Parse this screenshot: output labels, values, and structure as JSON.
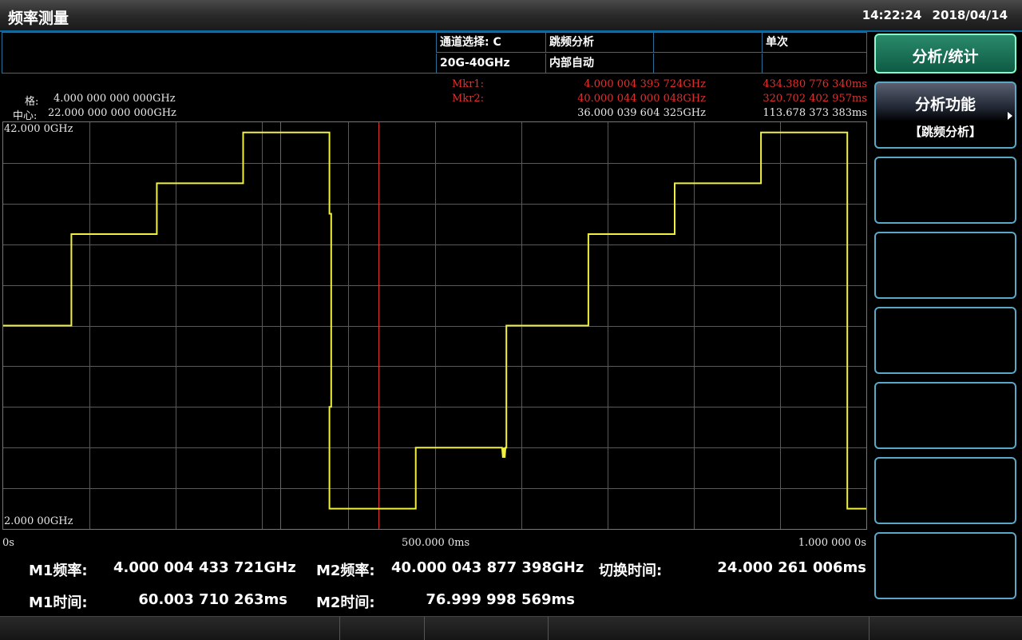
{
  "window": {
    "title": "频率测量",
    "time": "14:22:24",
    "date": "2018/04/14"
  },
  "info": {
    "channel_label": "通道选择: C",
    "band": "20G-40GHz",
    "mode": "跳频分析",
    "trigger": "内部自动",
    "sweep": "单次"
  },
  "scale": {
    "per_div_label": "格:",
    "per_div_value": "4.000 000 000 000GHz",
    "center_label": "中心:",
    "center_value": "22.000 000 000 000GHz"
  },
  "markers": {
    "mkr1_label": "Mkr1:",
    "mkr1_freq": "4.000 004 395 724GHz",
    "mkr1_time": "434.380 776 340ms",
    "mkr2_label": "Mkr2:",
    "mkr2_freq": "40.000 044 000 048GHz",
    "mkr2_time": "320.702 402 957ms",
    "delta_freq": "36.000 039 604 325GHz",
    "delta_time": "113.678 373 383ms"
  },
  "chart_data": {
    "type": "line",
    "y_top_label": "42.000 0GHz",
    "y_bottom_label": "2.000 00GHz",
    "x_start_label": "0s",
    "x_mid_label": "500.000 0ms",
    "x_end_label": "1.000 000 0s",
    "x_unit": "ms",
    "y_unit": "GHz",
    "xlim": [
      0,
      1000
    ],
    "ylim": [
      2,
      42
    ],
    "grid": true,
    "trace_color": "#f0f040",
    "marker_color": "#e03030",
    "marker_x": [
      320.7,
      434.4
    ],
    "series": [
      {
        "x": [
          0,
          79,
          79,
          178,
          178,
          278,
          278,
          378,
          378,
          380,
          380,
          378,
          378,
          380,
          380,
          478,
          478,
          578,
          578,
          579,
          580,
          581,
          582,
          583,
          583,
          678,
          678,
          778,
          778,
          878,
          878,
          978,
          978,
          1000
        ],
        "y": [
          22,
          22,
          31,
          31,
          36,
          36,
          41,
          41,
          33,
          33,
          14,
          14,
          4,
          4,
          4,
          4,
          10,
          10,
          10,
          9,
          10,
          9,
          10,
          10,
          22,
          22,
          31,
          31,
          36,
          36,
          41,
          41,
          4,
          4
        ]
      }
    ]
  },
  "results": {
    "m1_freq_label": "M1频率:",
    "m1_freq_value": "4.000 004 433 721GHz",
    "m2_freq_label": "M2频率:",
    "m2_freq_value": "40.000 043 877 398GHz",
    "switch_label": "切换时间:",
    "switch_value": "24.000 261 006ms",
    "m1_time_label": "M1时间:",
    "m1_time_value": "60.003 710 263ms",
    "m2_time_label": "M2时间:",
    "m2_time_value": "76.999 998 569ms"
  },
  "softkeys": {
    "sk0": "分析/统计",
    "sk1_title": "分析功能",
    "sk1_value": "【跳频分析】"
  }
}
